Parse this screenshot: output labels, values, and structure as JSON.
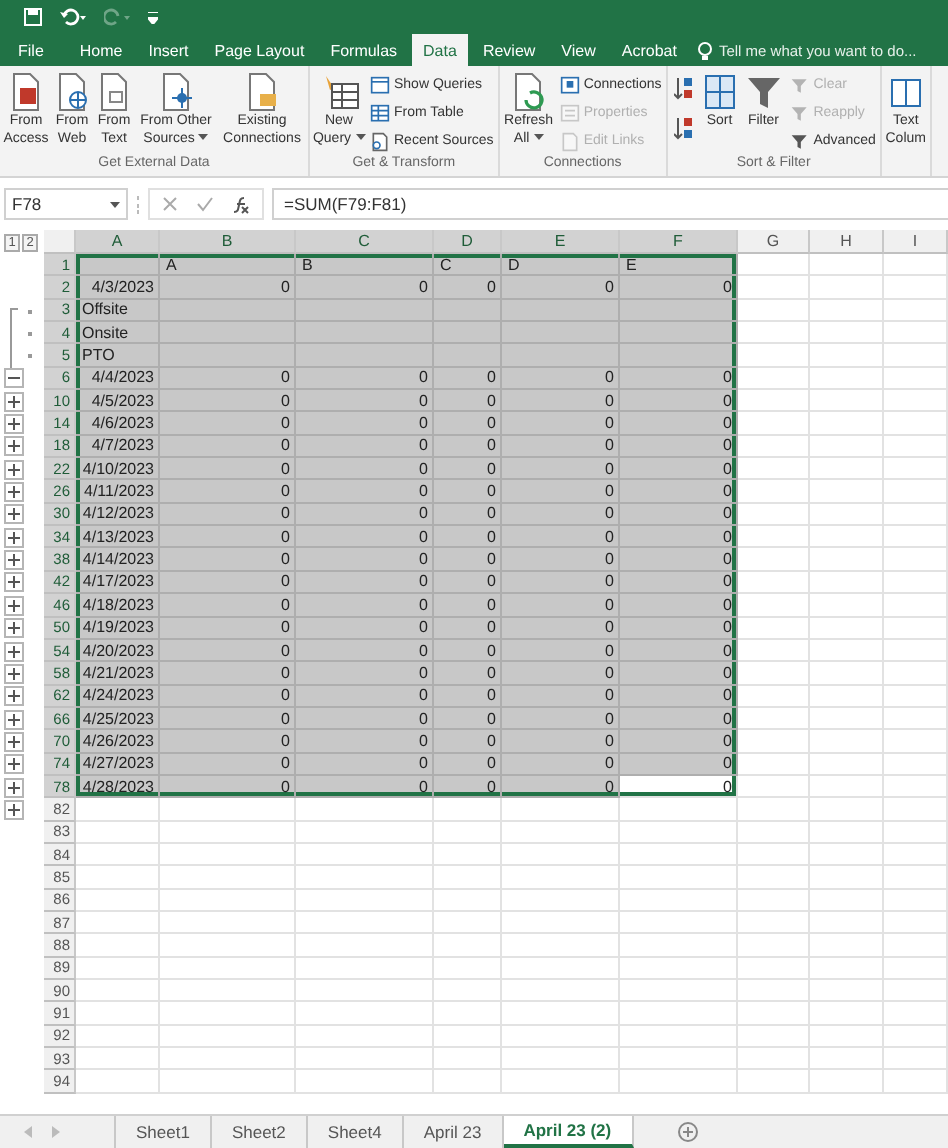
{
  "tabs": [
    {
      "label": "File",
      "selected": false
    },
    {
      "label": "Home",
      "selected": false
    },
    {
      "label": "Insert",
      "selected": false
    },
    {
      "label": "Page Layout",
      "selected": false
    },
    {
      "label": "Formulas",
      "selected": false
    },
    {
      "label": "Data",
      "selected": true
    },
    {
      "label": "Review",
      "selected": false
    },
    {
      "label": "View",
      "selected": false
    },
    {
      "label": "Acrobat",
      "selected": false
    }
  ],
  "tell_me": {
    "placeholder": "Tell me what you want to do..."
  },
  "ribbon": [
    {
      "label": "Get External Data",
      "buttons": [
        {
          "kind": "large",
          "label": "From Access",
          "dropdown": false
        },
        {
          "kind": "large",
          "label": "From Web",
          "dropdown": false
        },
        {
          "kind": "large",
          "label": "From Text",
          "dropdown": false
        },
        {
          "kind": "large",
          "label": "From Other Sources",
          "dropdown": true
        },
        {
          "kind": "large",
          "label": "Existing Connections",
          "dropdown": false
        }
      ]
    },
    {
      "label": "Get & Transform",
      "buttons": [
        {
          "kind": "large",
          "label": "New Query",
          "dropdown": true
        },
        {
          "kind": "small",
          "label": "Show Queries",
          "disabled": false
        },
        {
          "kind": "small",
          "label": "From Table",
          "disabled": false
        },
        {
          "kind": "small",
          "label": "Recent Sources",
          "disabled": false
        }
      ]
    },
    {
      "label": "Connections",
      "buttons": [
        {
          "kind": "large",
          "label": "Refresh All",
          "dropdown": true
        },
        {
          "kind": "small",
          "label": "Connections",
          "disabled": false
        },
        {
          "kind": "small",
          "label": "Properties",
          "disabled": true
        },
        {
          "kind": "small",
          "label": "Edit Links",
          "disabled": true
        }
      ]
    },
    {
      "label": "Sort & Filter",
      "buttons": [
        {
          "kind": "iconpair"
        },
        {
          "kind": "large",
          "label": "Sort",
          "dropdown": false
        },
        {
          "kind": "large",
          "label": "Filter",
          "dropdown": false
        },
        {
          "kind": "small",
          "label": "Clear",
          "disabled": true
        },
        {
          "kind": "small",
          "label": "Reapply",
          "disabled": true
        },
        {
          "kind": "small",
          "label": "Advanced",
          "disabled": false
        }
      ]
    },
    {
      "buttons": [
        {
          "kind": "large",
          "label": "Text Colum",
          "dropdown": false
        }
      ]
    }
  ],
  "name_box": "F78",
  "formula": "=SUM(F79:F81)",
  "outline_levels": [
    "1",
    "2"
  ],
  "columns": [
    "A",
    "B",
    "C",
    "D",
    "E",
    "F",
    "G",
    "H",
    "I"
  ],
  "rows": [
    {
      "number": "1",
      "grouped": false,
      "kind": "header",
      "selected": true,
      "cells": [
        null,
        "A",
        "B",
        "C",
        "D",
        "E"
      ]
    },
    {
      "number": "2",
      "grouped": false,
      "kind": "data",
      "selected": true,
      "cells": [
        "4/3/2023",
        "0",
        "0",
        "0",
        "0",
        "0"
      ]
    },
    {
      "number": "3",
      "grouped": true,
      "kind": "label",
      "selected": true,
      "cells": [
        "Offsite"
      ]
    },
    {
      "number": "4",
      "grouped": true,
      "kind": "label",
      "selected": true,
      "cells": [
        "Onsite"
      ]
    },
    {
      "number": "5",
      "grouped": true,
      "kind": "label",
      "selected": true,
      "cells": [
        "PTO"
      ]
    },
    {
      "number": "6",
      "grouped": false,
      "collapsed": false,
      "kind": "data",
      "selected": true,
      "cells": [
        "4/4/2023",
        "0",
        "0",
        "0",
        "0",
        "0"
      ]
    },
    {
      "number": "10",
      "grouped": false,
      "collapsed": true,
      "kind": "data",
      "selected": true,
      "cells": [
        "4/5/2023",
        "0",
        "0",
        "0",
        "0",
        "0"
      ]
    },
    {
      "number": "14",
      "grouped": false,
      "collapsed": true,
      "kind": "data",
      "selected": true,
      "cells": [
        "4/6/2023",
        "0",
        "0",
        "0",
        "0",
        "0"
      ]
    },
    {
      "number": "18",
      "grouped": false,
      "collapsed": true,
      "kind": "data",
      "selected": true,
      "cells": [
        "4/7/2023",
        "0",
        "0",
        "0",
        "0",
        "0"
      ]
    },
    {
      "number": "22",
      "grouped": false,
      "collapsed": true,
      "kind": "data",
      "selected": true,
      "cells": [
        "4/10/2023",
        "0",
        "0",
        "0",
        "0",
        "0"
      ]
    },
    {
      "number": "26",
      "grouped": false,
      "collapsed": true,
      "kind": "data",
      "selected": true,
      "cells": [
        "4/11/2023",
        "0",
        "0",
        "0",
        "0",
        "0"
      ]
    },
    {
      "number": "30",
      "grouped": false,
      "collapsed": true,
      "kind": "data",
      "selected": true,
      "cells": [
        "4/12/2023",
        "0",
        "0",
        "0",
        "0",
        "0"
      ]
    },
    {
      "number": "34",
      "grouped": false,
      "collapsed": true,
      "kind": "data",
      "selected": true,
      "cells": [
        "4/13/2023",
        "0",
        "0",
        "0",
        "0",
        "0"
      ]
    },
    {
      "number": "38",
      "grouped": false,
      "collapsed": true,
      "kind": "data",
      "selected": true,
      "cells": [
        "4/14/2023",
        "0",
        "0",
        "0",
        "0",
        "0"
      ]
    },
    {
      "number": "42",
      "grouped": false,
      "collapsed": true,
      "kind": "data",
      "selected": true,
      "cells": [
        "4/17/2023",
        "0",
        "0",
        "0",
        "0",
        "0"
      ]
    },
    {
      "number": "46",
      "grouped": false,
      "collapsed": true,
      "kind": "data",
      "selected": true,
      "cells": [
        "4/18/2023",
        "0",
        "0",
        "0",
        "0",
        "0"
      ]
    },
    {
      "number": "50",
      "grouped": false,
      "collapsed": true,
      "kind": "data",
      "selected": true,
      "cells": [
        "4/19/2023",
        "0",
        "0",
        "0",
        "0",
        "0"
      ]
    },
    {
      "number": "54",
      "grouped": false,
      "collapsed": true,
      "kind": "data",
      "selected": true,
      "cells": [
        "4/20/2023",
        "0",
        "0",
        "0",
        "0",
        "0"
      ]
    },
    {
      "number": "58",
      "grouped": false,
      "collapsed": true,
      "kind": "data",
      "selected": true,
      "cells": [
        "4/21/2023",
        "0",
        "0",
        "0",
        "0",
        "0"
      ]
    },
    {
      "number": "62",
      "grouped": false,
      "collapsed": true,
      "kind": "data",
      "selected": true,
      "cells": [
        "4/24/2023",
        "0",
        "0",
        "0",
        "0",
        "0"
      ]
    },
    {
      "number": "66",
      "grouped": false,
      "collapsed": true,
      "kind": "data",
      "selected": true,
      "cells": [
        "4/25/2023",
        "0",
        "0",
        "0",
        "0",
        "0"
      ]
    },
    {
      "number": "70",
      "grouped": false,
      "collapsed": true,
      "kind": "data",
      "selected": true,
      "cells": [
        "4/26/2023",
        "0",
        "0",
        "0",
        "0",
        "0"
      ]
    },
    {
      "number": "74",
      "grouped": false,
      "collapsed": true,
      "kind": "data",
      "selected": true,
      "cells": [
        "4/27/2023",
        "0",
        "0",
        "0",
        "0",
        "0"
      ]
    },
    {
      "number": "78",
      "grouped": false,
      "collapsed": true,
      "kind": "data",
      "selected": true,
      "cells": [
        "4/28/2023",
        "0",
        "0",
        "0",
        "0",
        {
          "text": "0",
          "active": true
        }
      ]
    },
    {
      "number": "82",
      "grouped": false,
      "collapsed": true,
      "kind": "blank",
      "selected": false
    },
    {
      "number": "83",
      "grouped": false,
      "kind": "blank",
      "selected": false
    },
    {
      "number": "84",
      "grouped": false,
      "kind": "blank",
      "selected": false
    },
    {
      "number": "85",
      "grouped": false,
      "kind": "blank",
      "selected": false
    },
    {
      "number": "86",
      "grouped": false,
      "kind": "blank",
      "selected": false
    },
    {
      "number": "87",
      "grouped": false,
      "kind": "blank",
      "selected": false
    },
    {
      "number": "88",
      "grouped": false,
      "kind": "blank",
      "selected": false
    },
    {
      "number": "89",
      "grouped": false,
      "kind": "blank",
      "selected": false
    },
    {
      "number": "90",
      "grouped": false,
      "kind": "blank",
      "selected": false
    },
    {
      "number": "91",
      "grouped": false,
      "kind": "blank",
      "selected": false
    },
    {
      "number": "92",
      "grouped": false,
      "kind": "blank",
      "selected": false
    },
    {
      "number": "93",
      "grouped": false,
      "kind": "blank",
      "selected": false
    },
    {
      "number": "94",
      "grouped": false,
      "kind": "blank",
      "selected": false
    }
  ],
  "sheets": [
    {
      "label": "Sheet1",
      "selected": false
    },
    {
      "label": "Sheet2",
      "selected": false
    },
    {
      "label": "Sheet4",
      "selected": false
    },
    {
      "label": "April 23",
      "selected": false
    },
    {
      "label": "April 23 (2)",
      "selected": true
    }
  ]
}
